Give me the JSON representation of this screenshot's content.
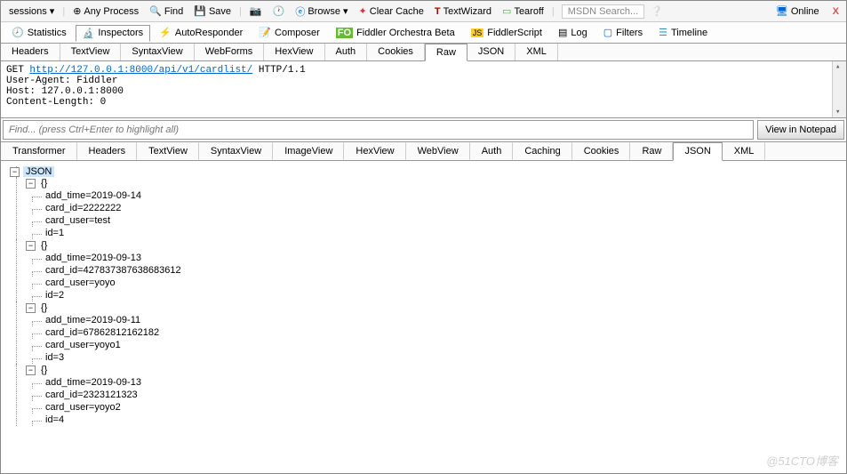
{
  "toolbar": {
    "sessions": "sessions",
    "arrow": "▸",
    "anyproc": "Any Process",
    "find": "Find",
    "save": "Save",
    "browse": "Browse",
    "clear": "Clear Cache",
    "wizard": "TextWizard",
    "tearoff": "Tearoff",
    "search": "MSDN Search...",
    "online": "Online"
  },
  "main_tabs": [
    {
      "label": "Statistics"
    },
    {
      "label": "Inspectors"
    },
    {
      "label": "AutoResponder"
    },
    {
      "label": "Composer"
    },
    {
      "label": "Fiddler Orchestra Beta"
    },
    {
      "label": "FiddlerScript"
    },
    {
      "label": "Log"
    },
    {
      "label": "Filters"
    },
    {
      "label": "Timeline"
    }
  ],
  "req_tabs": [
    "Headers",
    "TextView",
    "SyntaxView",
    "WebForms",
    "HexView",
    "Auth",
    "Cookies",
    "Raw",
    "JSON",
    "XML"
  ],
  "raw": {
    "method": "GET",
    "url": "http://127.0.0.1:8000/api/v1/cardlist/",
    "proto": "HTTP/1.1",
    "ua": "User-Agent: Fiddler",
    "host": "Host: 127.0.0.1:8000",
    "cl": "Content-Length: 0"
  },
  "find": {
    "placeholder": "Find... (press Ctrl+Enter to highlight all)",
    "button": "View in Notepad"
  },
  "resp_tabs": [
    "Transformer",
    "Headers",
    "TextView",
    "SyntaxView",
    "ImageView",
    "HexView",
    "WebView",
    "Auth",
    "Caching",
    "Cookies",
    "Raw",
    "JSON",
    "XML"
  ],
  "json_root": "JSON",
  "items": [
    {
      "add_time": "2019-09-14",
      "card_id": "2222222",
      "card_user": "test",
      "id": "1"
    },
    {
      "add_time": "2019-09-13",
      "card_id": "427837387638683612",
      "card_user": "yoyo",
      "id": "2"
    },
    {
      "add_time": "2019-09-11",
      "card_id": "67862812162182",
      "card_user": "yoyo1",
      "id": "3"
    },
    {
      "add_time": "2019-09-13",
      "card_id": "2323121323",
      "card_user": "yoyo2",
      "id": "4"
    }
  ],
  "watermark": "@51CTO博客"
}
